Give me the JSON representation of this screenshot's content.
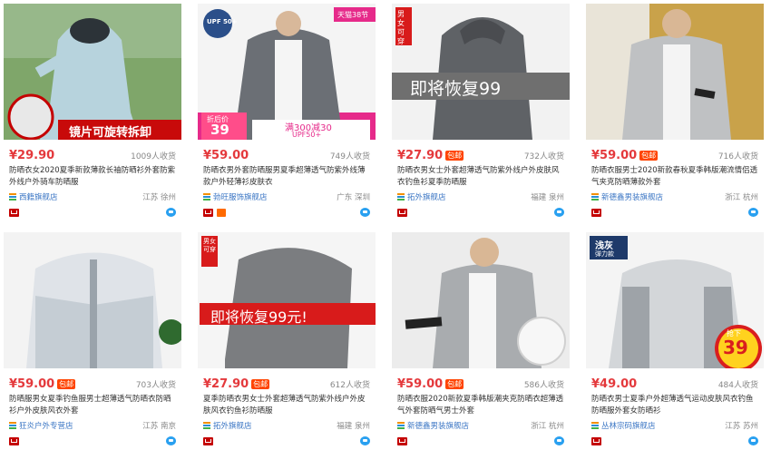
{
  "products": [
    {
      "price": "¥29.90",
      "free_shipping": "",
      "sold": "1009人收货",
      "title": "防晒衣女2020夏季新款薄款长袖防晒衫外套防紫外线户外骑车防晒服",
      "shop": "西籍旗舰店",
      "location": "江苏 徐州",
      "overlay": "镜片可旋转拆卸",
      "badge": "",
      "badge2": ""
    },
    {
      "price": "¥59.00",
      "free_shipping": "",
      "sold": "749人收货",
      "title": "防晒衣男外套防晒服男夏季超薄透气防紫外线薄款户外轻薄衫皮肤衣",
      "shop": "勃旺服饰旗舰店",
      "location": "广东 深圳",
      "overlay": "满300减30",
      "badge": "UPF 50+",
      "badge2": "天猫38节",
      "sub1": "折后价",
      "sub2": "39",
      "sub3": "UPF50+"
    },
    {
      "price": "¥27.90",
      "free_shipping": "包邮",
      "sold": "732人收货",
      "title": "防晒衣男女士外套超薄透气防紫外线户外皮肤风衣钓鱼衫夏季防晒服",
      "shop": "拓外旗舰店",
      "location": "福建 泉州",
      "overlay": "即将恢复99",
      "badge": "男女可穿",
      "badge2": ""
    },
    {
      "price": "¥59.00",
      "free_shipping": "包邮",
      "sold": "716人收货",
      "title": "防晒衣服男士2020新款春秋夏季韩版潮流情侣透气夹克防晒薄款外套",
      "shop": "新德鑫男装旗舰店",
      "location": "浙江 杭州",
      "overlay": "",
      "badge": "",
      "badge2": ""
    },
    {
      "price": "¥59.00",
      "free_shipping": "包邮",
      "sold": "703人收货",
      "title": "防晒服男女夏季钓鱼服男士超薄透气防晒衣防晒衫户外皮肤风衣外套",
      "shop": "狂炎户外专营店",
      "location": "江苏 南京",
      "overlay": "",
      "badge": "",
      "badge2": ""
    },
    {
      "price": "¥27.90",
      "free_shipping": "包邮",
      "sold": "612人收货",
      "title": "夏季防晒衣男女士外套超薄透气防紫外线户外皮肤风衣钓鱼衫防晒服",
      "shop": "拓外旗舰店",
      "location": "福建 泉州",
      "overlay": "即将恢复99元!",
      "badge": "男女可穿",
      "badge2": ""
    },
    {
      "price": "¥59.00",
      "free_shipping": "包邮",
      "sold": "586人收货",
      "title": "防晒衣服2020新款夏季韩版潮夹克防晒衣超薄透气外套防晒气男士外套",
      "shop": "新德鑫男装旗舰店",
      "location": "浙江 杭州",
      "overlay": "",
      "badge": "",
      "badge2": ""
    },
    {
      "price": "¥49.00",
      "free_shipping": "",
      "sold": "484人收货",
      "title": "防晒衣男士夏季户外超薄透气运动皮肤风衣钓鱼防晒服外套女防晒衫",
      "shop": "丛林宗码旗舰店",
      "location": "江苏 苏州",
      "overlay": "39",
      "badge": "浅灰",
      "badge2": "弹力款",
      "sub1": "抢下"
    }
  ]
}
